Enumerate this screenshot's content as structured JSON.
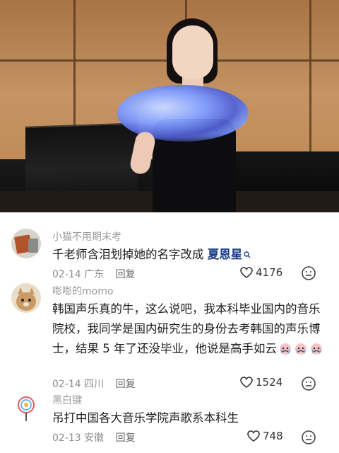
{
  "video": {
    "description_icon": "concert-stage-photo"
  },
  "comments": [
    {
      "username": "小猫不用期末考",
      "text_prefix": "千老师含泪划掉她的名字改成 ",
      "highlight": "夏恩星",
      "highlight_icon": "search-icon",
      "date": "02-14",
      "location": "广东",
      "reply": "回复",
      "likes": "4176"
    },
    {
      "username": "嘭嘭的momo",
      "text": "韩国声乐真的牛，这么说吧，我本科毕业国内的音乐院校，我同学是国内研究生的身份去考韩国的声乐博士，结果 5 年了还没毕业，他说是高手如云",
      "emoji_icons": [
        "ke-emoji-icon",
        "ke-emoji-icon",
        "ke-emoji-icon"
      ],
      "date": "02-14",
      "location": "四川",
      "reply": "回复",
      "likes": "1524"
    },
    {
      "username": "黑白键",
      "text": "吊打中国各大音乐学院声歌系本科生",
      "date": "02-13",
      "location": "安徽",
      "reply": "回复",
      "likes": "748"
    }
  ]
}
